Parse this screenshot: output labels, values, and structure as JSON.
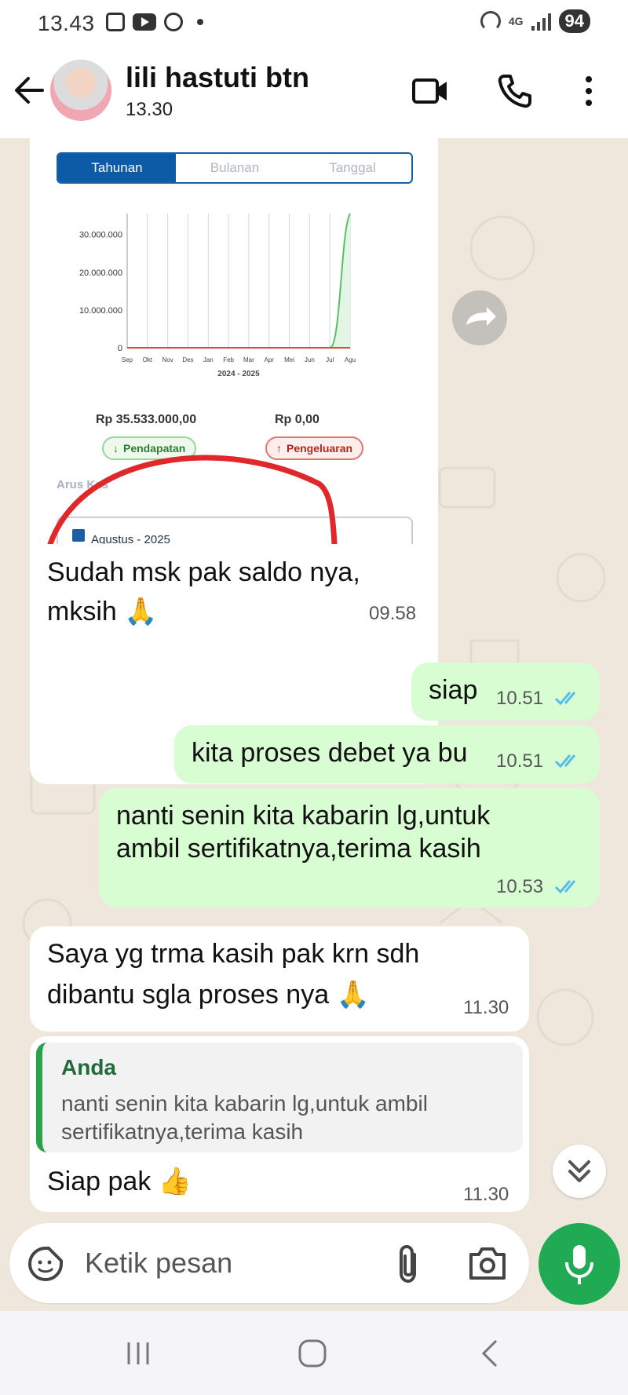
{
  "status_bar": {
    "time": "13.43",
    "network": "4G",
    "battery": "94"
  },
  "header": {
    "name": "lili hastuti btn",
    "subtitle": "13.30"
  },
  "shared_image": {
    "tabs": [
      "Tahunan",
      "Bulanan",
      "Tanggal"
    ],
    "active_tab": "Tahunan",
    "pendapatan_amount": "Rp 35.533.000,00",
    "pengeluaran_amount": "Rp 0,00",
    "pendapatan_label": "Pendapatan",
    "pengeluaran_label": "Pengeluaran",
    "arus_kas": "Arus Kas",
    "date_label": "Agustus - 2025"
  },
  "chart_data": {
    "type": "line",
    "x": [
      "Sep",
      "Okt",
      "Nov",
      "Des",
      "Jan",
      "Feb",
      "Mar",
      "Apr",
      "Mei",
      "Jun",
      "Jul",
      "Agu"
    ],
    "xlabel": "2024 - 2025",
    "ylabel": "",
    "ytick_labels": [
      "30.000.000",
      "20.000.000",
      "10.000.000",
      "0"
    ],
    "ylim": [
      0,
      35533000
    ],
    "series": [
      {
        "values": [
          0,
          0,
          0,
          0,
          0,
          0,
          0,
          0,
          0,
          0,
          0,
          35533000
        ],
        "color": "#5bbf6a"
      },
      {
        "values": [
          0,
          0,
          0,
          0,
          0,
          0,
          0,
          0,
          0,
          0,
          0,
          0
        ],
        "color": "#d94b3f"
      }
    ],
    "grid": true
  },
  "messages": {
    "m1": {
      "text1": "Sudah msk pak saldo nya,",
      "text2": "mksih 🙏",
      "time": "09.58"
    },
    "m2": {
      "text": "siap",
      "time": "10.51"
    },
    "m3": {
      "text": "kita proses debet ya bu",
      "time": "10.51"
    },
    "m4": {
      "text1": "nanti senin kita kabarin lg,untuk",
      "text2": "ambil sertifikatnya,terima kasih",
      "time": "10.53"
    },
    "m5": {
      "text1": "Saya yg trma kasih pak krn sdh",
      "text2": "dibantu sgla proses nya 🙏",
      "time": "11.30"
    },
    "m6": {
      "quote_author": "Anda",
      "quote_text": "nanti senin kita kabarin lg,untuk ambil sertifikatnya,terima kasih",
      "text": "Siap pak 👍",
      "time": "11.30"
    }
  },
  "input": {
    "placeholder": "Ketik pesan"
  },
  "colors": {
    "accent": "#1faa53",
    "outgoing": "#d9fdd3",
    "tick_blue": "#53bdeb"
  }
}
